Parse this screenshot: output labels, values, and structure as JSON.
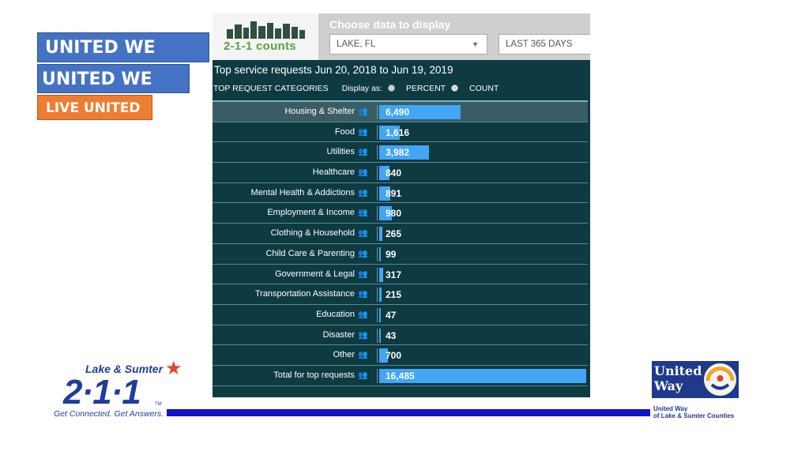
{
  "slogans": {
    "line1": "UNITED WE FIGHT",
    "line2": "UNITED WE WIN",
    "line3": "LIVE UNITED"
  },
  "dashboard": {
    "logo_text": "2-1-1 counts",
    "choose_label": "Choose data to display",
    "location_select": "LAKE, FL",
    "period_select": "LAST 365 DAYS",
    "title": "Top service requests Jun 20, 2018 to Jun 19, 2019",
    "categories_label": "TOP REQUEST CATEGORIES",
    "display_as_label": "Display as:",
    "option_percent": "PERCENT",
    "option_count": "COUNT",
    "rows": [
      {
        "label": "Housing & Shelter",
        "value": "6,490",
        "num": 6490
      },
      {
        "label": "Food",
        "value": "1,616",
        "num": 1616
      },
      {
        "label": "Utilities",
        "value": "3,982",
        "num": 3982
      },
      {
        "label": "Healthcare",
        "value": "840",
        "num": 840
      },
      {
        "label": "Mental Health & Addictions",
        "value": "891",
        "num": 891
      },
      {
        "label": "Employment & Income",
        "value": "980",
        "num": 980
      },
      {
        "label": "Clothing & Household",
        "value": "265",
        "num": 265
      },
      {
        "label": "Child Care & Parenting",
        "value": "99",
        "num": 99
      },
      {
        "label": "Government & Legal",
        "value": "317",
        "num": 317
      },
      {
        "label": "Transportation Assistance",
        "value": "215",
        "num": 215
      },
      {
        "label": "Education",
        "value": "47",
        "num": 47
      },
      {
        "label": "Disaster",
        "value": "43",
        "num": 43
      },
      {
        "label": "Other",
        "value": "700",
        "num": 700
      },
      {
        "label": "Total for top requests",
        "value": "16,485",
        "num": 16485
      }
    ]
  },
  "branding": {
    "lake_sumter": "Lake & Sumter",
    "big_211": "2·1·1",
    "tagline": "Get Connected. Get Answers.",
    "tm": "TM",
    "uw_line1": "United",
    "uw_line2": "Way",
    "uw_sub1": "United Way",
    "uw_sub2": "of Lake & Sumter Counties"
  },
  "colors": {
    "bar": "#42a5f5",
    "panel": "#0e3a42",
    "slogan_blue": "#4472c4",
    "slogan_orange": "#ed7d31",
    "brand_blue": "#1f3d99"
  }
}
